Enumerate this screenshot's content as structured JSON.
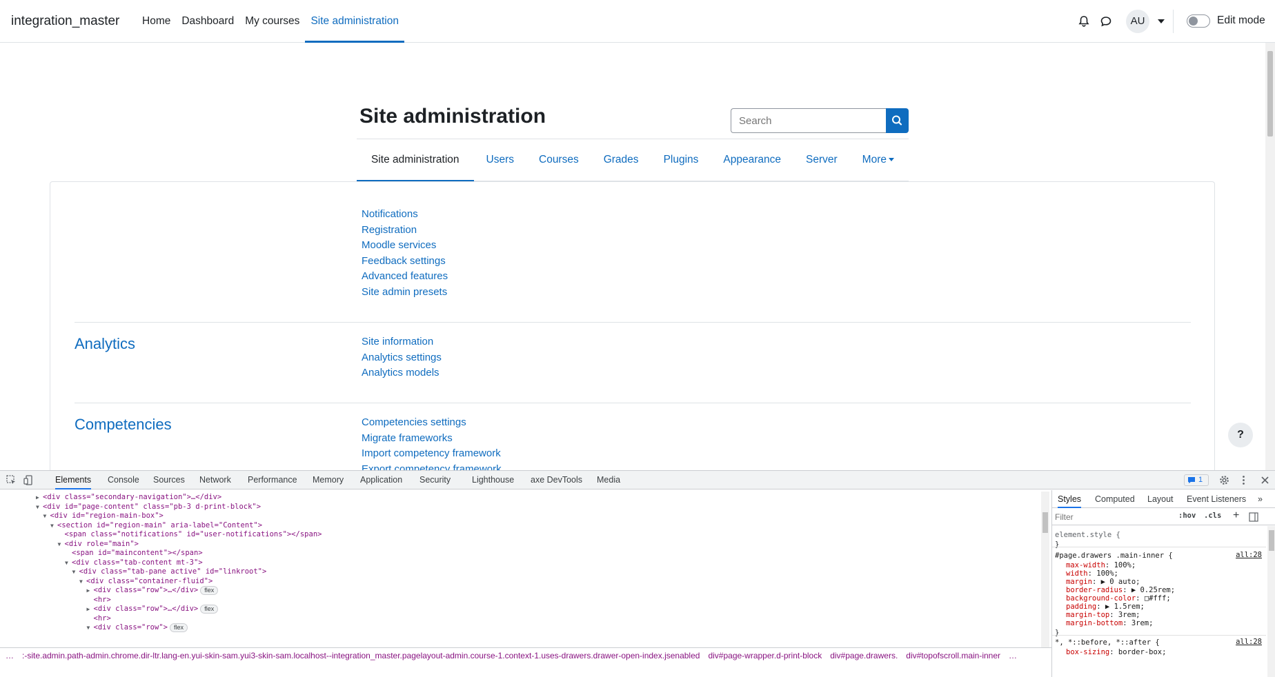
{
  "header": {
    "brand": "integration_master",
    "nav": [
      "Home",
      "Dashboard",
      "My courses",
      "Site administration"
    ],
    "avatar_initials": "AU",
    "edit_mode_label": "Edit mode"
  },
  "page": {
    "title": "Site administration",
    "search_placeholder": "Search",
    "tabs": [
      "Site administration",
      "Users",
      "Courses",
      "Grades",
      "Plugins",
      "Appearance",
      "Server",
      "More"
    ],
    "general_links": [
      "Notifications",
      "Registration",
      "Moodle services",
      "Feedback settings",
      "Advanced features",
      "Site admin presets"
    ],
    "sections": [
      {
        "heading": "Analytics",
        "links": [
          "Site information",
          "Analytics settings",
          "Analytics models"
        ]
      },
      {
        "heading": "Competencies",
        "links": [
          "Competencies settings",
          "Migrate frameworks",
          "Import competency framework",
          "Export competency framework"
        ]
      }
    ],
    "help_label": "?"
  },
  "devtools": {
    "tabs": [
      "Elements",
      "Console",
      "Sources",
      "Network",
      "Performance",
      "Memory",
      "Application",
      "Security",
      "Lighthouse",
      "axe DevTools",
      "Media"
    ],
    "issues_count": "1",
    "dom_lines": [
      {
        "indent": 0,
        "tri": "▶",
        "text": "<div class=\"secondary-navigation\">…</div>"
      },
      {
        "indent": 0,
        "tri": "▼",
        "text": "<div id=\"page-content\" class=\"pb-3 d-print-block\">"
      },
      {
        "indent": 1,
        "tri": "▼",
        "text": "<div id=\"region-main-box\">"
      },
      {
        "indent": 2,
        "tri": "▼",
        "text": "<section id=\"region-main\" aria-label=\"Content\">"
      },
      {
        "indent": 3,
        "tri": "",
        "text": "<span class=\"notifications\" id=\"user-notifications\"></span>"
      },
      {
        "indent": 3,
        "tri": "▼",
        "text": "<div role=\"main\">"
      },
      {
        "indent": 4,
        "tri": "",
        "text": "<span id=\"maincontent\"></span>"
      },
      {
        "indent": 4,
        "tri": "▼",
        "text": "<div class=\"tab-content mt-3\">"
      },
      {
        "indent": 5,
        "tri": "▼",
        "text": "<div class=\"tab-pane active\" id=\"linkroot\">"
      },
      {
        "indent": 6,
        "tri": "▼",
        "text": "<div class=\"container-fluid\">"
      },
      {
        "indent": 7,
        "tri": "▶",
        "text": "<div class=\"row\">…</div>",
        "badge": "flex"
      },
      {
        "indent": 7,
        "tri": "",
        "text": "<hr>"
      },
      {
        "indent": 7,
        "tri": "▶",
        "text": "<div class=\"row\">…</div>",
        "badge": "flex"
      },
      {
        "indent": 7,
        "tri": "",
        "text": "<hr>"
      },
      {
        "indent": 7,
        "tri": "▼",
        "text": "<div class=\"row\">",
        "badge": "flex"
      }
    ],
    "breadcrumbs": [
      "…",
      ":-site.admin.path-admin.chrome.dir-ltr.lang-en.yui-skin-sam.yui3-skin-sam.localhost--integration_master.pagelayout-admin.course-1.context-1.uses-drawers.drawer-open-index.jsenabled",
      "div#page-wrapper.d-print-block",
      "div#page.drawers.",
      "div#topofscroll.main-inner",
      "…"
    ],
    "styles_tabs": [
      "Styles",
      "Computed",
      "Layout",
      "Event Listeners"
    ],
    "filter_placeholder": "Filter",
    "hov_label": ":hov",
    "cls_label": ".cls",
    "element_style": "element.style {",
    "rule_selector": "#page.drawers .main-inner {",
    "rule_source": "all:28",
    "rule_props": [
      {
        "name": "max-width",
        "value": "100%;"
      },
      {
        "name": "width",
        "value": "100%;"
      },
      {
        "name": "margin",
        "value": "▶ 0 auto;"
      },
      {
        "name": "border-radius",
        "value": "▶ 0.25rem;"
      },
      {
        "name": "background-color",
        "value": "□#fff;"
      },
      {
        "name": "padding",
        "value": "▶ 1.5rem;"
      },
      {
        "name": "margin-top",
        "value": "3rem;"
      },
      {
        "name": "margin-bottom",
        "value": "3rem;"
      }
    ],
    "rule2_selector": "*, *::before, *::after {",
    "rule2_source": "all:28",
    "rule2_prop": {
      "name": "box-sizing",
      "value": "border-box;"
    }
  }
}
